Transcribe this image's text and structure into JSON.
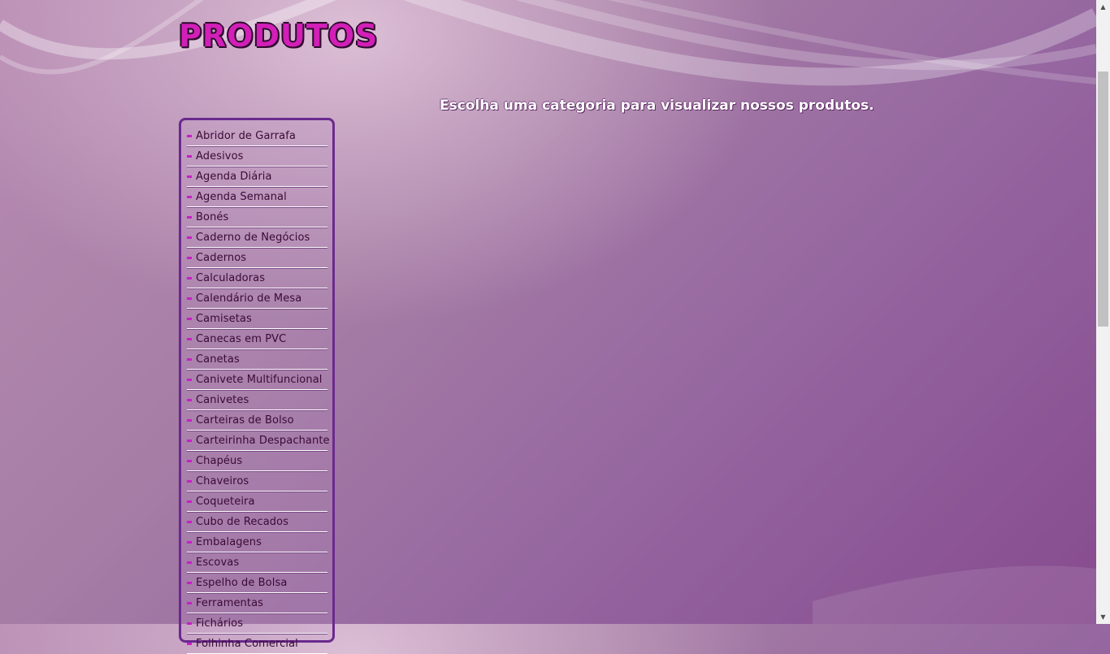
{
  "page": {
    "title": "PRODUTOS",
    "prompt": "Escolha uma categoria para visualizar nossos produtos."
  },
  "menu": {
    "items": [
      {
        "label": "Abridor de Garrafa"
      },
      {
        "label": "Adesivos"
      },
      {
        "label": "Agenda Diária"
      },
      {
        "label": "Agenda Semanal"
      },
      {
        "label": "Bonés"
      },
      {
        "label": "Caderno de Negócios"
      },
      {
        "label": "Cadernos"
      },
      {
        "label": "Calculadoras"
      },
      {
        "label": "Calendário de Mesa"
      },
      {
        "label": "Camisetas"
      },
      {
        "label": "Canecas em PVC"
      },
      {
        "label": "Canetas"
      },
      {
        "label": "Canivete Multifuncional"
      },
      {
        "label": "Canivetes"
      },
      {
        "label": "Carteiras de Bolso"
      },
      {
        "label": "Carteirinha Despachante"
      },
      {
        "label": "Chapéus"
      },
      {
        "label": "Chaveiros"
      },
      {
        "label": "Coqueteira"
      },
      {
        "label": "Cubo de Recados"
      },
      {
        "label": "Embalagens"
      },
      {
        "label": "Escovas"
      },
      {
        "label": "Espelho de Bolsa"
      },
      {
        "label": "Ferramentas"
      },
      {
        "label": "Fichários"
      },
      {
        "label": "Folhinha Comercial"
      }
    ]
  },
  "scroll": {
    "position": 0.17
  },
  "colors": {
    "title": "#d21fb7",
    "menu_border": "#6a2a8e",
    "bullet": "#c81ec8",
    "menu_text": "#3a0a35"
  }
}
